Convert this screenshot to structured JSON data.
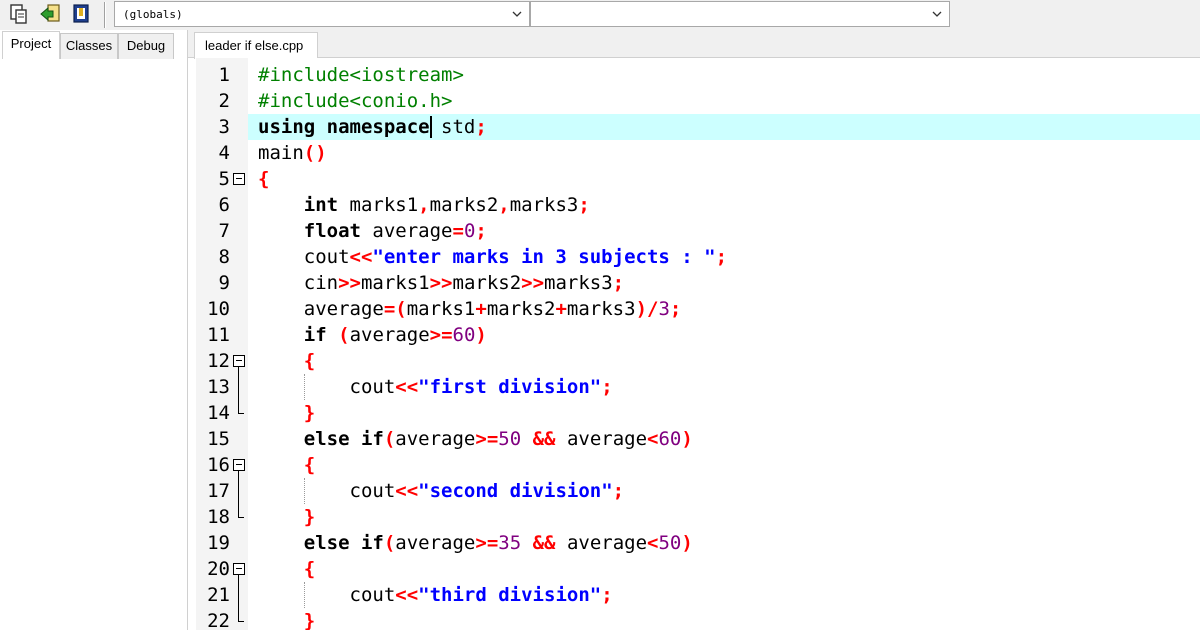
{
  "toolbar": {
    "buttons": [
      {
        "name": "toggle-tab-icon"
      },
      {
        "name": "goto-icon"
      },
      {
        "name": "bookmark-icon"
      }
    ],
    "scope_combo": {
      "value": "(globals)"
    },
    "member_combo": {
      "value": ""
    }
  },
  "left_panel": {
    "tabs": [
      "Project",
      "Classes",
      "Debug"
    ],
    "active_tab": "Project"
  },
  "editor": {
    "file_tab": "leader if else.cpp",
    "current_line": 3,
    "colors": {
      "preprocessor": "#008000",
      "operator": "#ff0000",
      "string": "#0000ff",
      "number": "#800080",
      "highlight": "#ccffff"
    },
    "lines": [
      {
        "n": "1",
        "tokens": [
          [
            "pp",
            "#include<iostream>"
          ]
        ]
      },
      {
        "n": "2",
        "tokens": [
          [
            "pp",
            "#include<conio.h>"
          ]
        ]
      },
      {
        "n": "3",
        "tokens": [
          [
            "kw",
            "using namespace"
          ],
          [
            "id",
            " std"
          ],
          [
            "op",
            ";"
          ]
        ]
      },
      {
        "n": "4",
        "tokens": [
          [
            "id",
            "main"
          ],
          [
            "op",
            "()"
          ]
        ]
      },
      {
        "n": "5",
        "fold": "start",
        "tokens": [
          [
            "op",
            "{"
          ]
        ]
      },
      {
        "n": "6",
        "tokens": [
          [
            "id",
            "    "
          ],
          [
            "kw",
            "int"
          ],
          [
            "id",
            " marks1"
          ],
          [
            "op",
            ","
          ],
          [
            "id",
            "marks2"
          ],
          [
            "op",
            ","
          ],
          [
            "id",
            "marks3"
          ],
          [
            "op",
            ";"
          ]
        ]
      },
      {
        "n": "7",
        "tokens": [
          [
            "id",
            "    "
          ],
          [
            "kw",
            "float"
          ],
          [
            "id",
            " average"
          ],
          [
            "op",
            "="
          ],
          [
            "num",
            "0"
          ],
          [
            "op",
            ";"
          ]
        ]
      },
      {
        "n": "8",
        "tokens": [
          [
            "id",
            "    cout"
          ],
          [
            "op",
            "<<"
          ],
          [
            "str",
            "\"enter marks in 3 subjects : \""
          ],
          [
            "op",
            ";"
          ]
        ]
      },
      {
        "n": "9",
        "tokens": [
          [
            "id",
            "    cin"
          ],
          [
            "op",
            ">>"
          ],
          [
            "id",
            "marks1"
          ],
          [
            "op",
            ">>"
          ],
          [
            "id",
            "marks2"
          ],
          [
            "op",
            ">>"
          ],
          [
            "id",
            "marks3"
          ],
          [
            "op",
            ";"
          ]
        ]
      },
      {
        "n": "10",
        "tokens": [
          [
            "id",
            "    average"
          ],
          [
            "op",
            "=("
          ],
          [
            "id",
            "marks1"
          ],
          [
            "op",
            "+"
          ],
          [
            "id",
            "marks2"
          ],
          [
            "op",
            "+"
          ],
          [
            "id",
            "marks3"
          ],
          [
            "op",
            ")/"
          ],
          [
            "num",
            "3"
          ],
          [
            "op",
            ";"
          ]
        ]
      },
      {
        "n": "11",
        "tokens": [
          [
            "id",
            "    "
          ],
          [
            "kw",
            "if"
          ],
          [
            "id",
            " "
          ],
          [
            "op",
            "("
          ],
          [
            "id",
            "average"
          ],
          [
            "op",
            ">="
          ],
          [
            "num",
            "60"
          ],
          [
            "op",
            ")"
          ]
        ]
      },
      {
        "n": "12",
        "fold": "start",
        "tokens": [
          [
            "id",
            "    "
          ],
          [
            "op",
            "{"
          ]
        ]
      },
      {
        "n": "13",
        "guide": true,
        "tokens": [
          [
            "id",
            "        cout"
          ],
          [
            "op",
            "<<"
          ],
          [
            "str",
            "\"first division\""
          ],
          [
            "op",
            ";"
          ]
        ]
      },
      {
        "n": "14",
        "fold": "end",
        "tokens": [
          [
            "id",
            "    "
          ],
          [
            "op",
            "}"
          ]
        ]
      },
      {
        "n": "15",
        "tokens": [
          [
            "id",
            "    "
          ],
          [
            "kw",
            "else if"
          ],
          [
            "op",
            "("
          ],
          [
            "id",
            "average"
          ],
          [
            "op",
            ">="
          ],
          [
            "num",
            "50"
          ],
          [
            "id",
            " "
          ],
          [
            "op",
            "&&"
          ],
          [
            "id",
            " average"
          ],
          [
            "op",
            "<"
          ],
          [
            "num",
            "60"
          ],
          [
            "op",
            ")"
          ]
        ]
      },
      {
        "n": "16",
        "fold": "start",
        "tokens": [
          [
            "id",
            "    "
          ],
          [
            "op",
            "{"
          ]
        ]
      },
      {
        "n": "17",
        "guide": true,
        "tokens": [
          [
            "id",
            "        cout"
          ],
          [
            "op",
            "<<"
          ],
          [
            "str",
            "\"second division\""
          ],
          [
            "op",
            ";"
          ]
        ]
      },
      {
        "n": "18",
        "fold": "end",
        "tokens": [
          [
            "id",
            "    "
          ],
          [
            "op",
            "}"
          ]
        ]
      },
      {
        "n": "19",
        "tokens": [
          [
            "id",
            "    "
          ],
          [
            "kw",
            "else if"
          ],
          [
            "op",
            "("
          ],
          [
            "id",
            "average"
          ],
          [
            "op",
            ">="
          ],
          [
            "num",
            "35"
          ],
          [
            "id",
            " "
          ],
          [
            "op",
            "&&"
          ],
          [
            "id",
            " average"
          ],
          [
            "op",
            "<"
          ],
          [
            "num",
            "50"
          ],
          [
            "op",
            ")"
          ]
        ]
      },
      {
        "n": "20",
        "fold": "start",
        "tokens": [
          [
            "id",
            "    "
          ],
          [
            "op",
            "{"
          ]
        ]
      },
      {
        "n": "21",
        "guide": true,
        "tokens": [
          [
            "id",
            "        cout"
          ],
          [
            "op",
            "<<"
          ],
          [
            "str",
            "\"third division\""
          ],
          [
            "op",
            ";"
          ]
        ]
      },
      {
        "n": "22",
        "fold": "end",
        "tokens": [
          [
            "id",
            "    "
          ],
          [
            "op",
            "}"
          ]
        ]
      }
    ]
  }
}
